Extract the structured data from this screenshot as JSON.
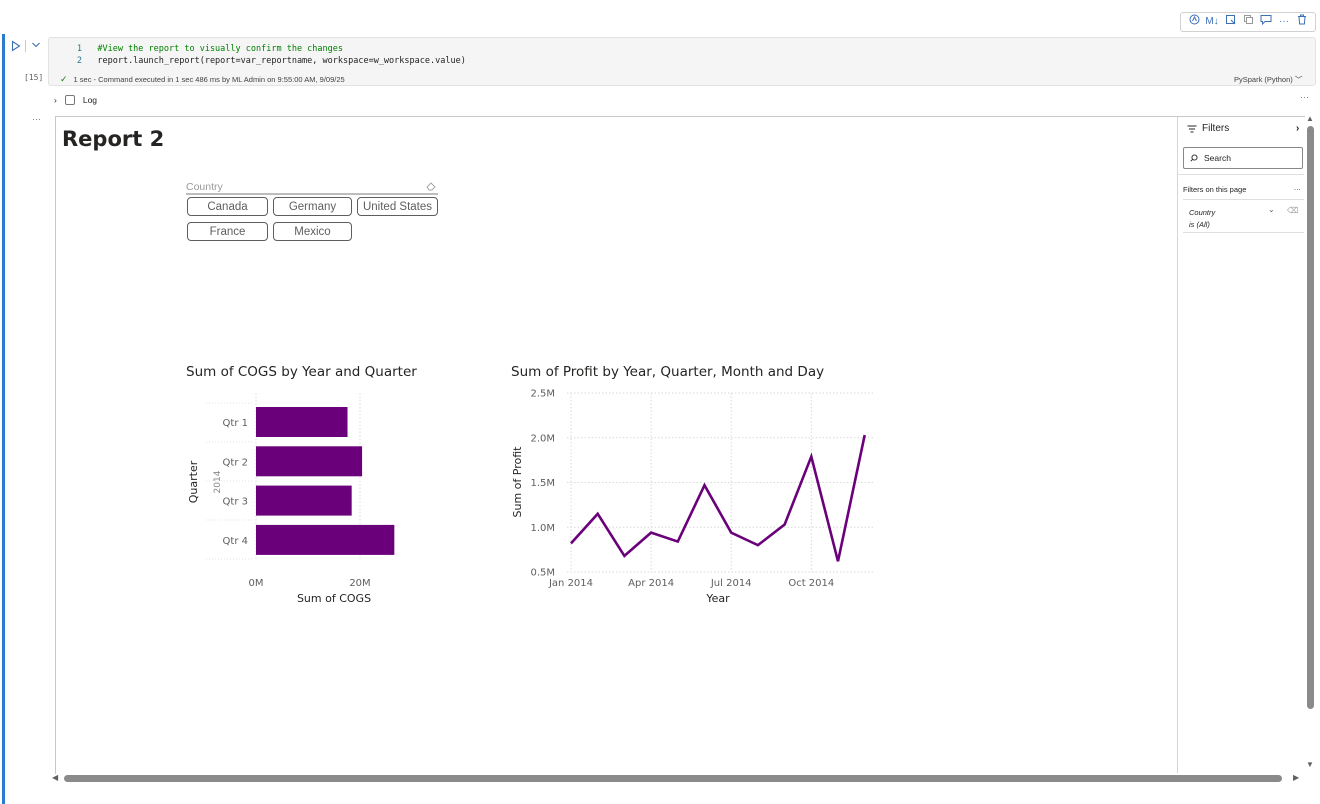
{
  "toolbar": {
    "icons": [
      "copilot-icon",
      "markdown-icon",
      "freeze-icon",
      "copy-icon",
      "comment-icon",
      "more-icon",
      "delete-icon"
    ],
    "markdown_label": "M↓"
  },
  "cell": {
    "execution_count": "[15]",
    "code_lines": [
      {
        "num": "1",
        "text": "#View the report to visually confirm the changes"
      },
      {
        "num": "2",
        "text": "report.launch_report(report=var_reportname, workspace=w_workspace.value)"
      }
    ],
    "status": "1 sec - Command executed in 1 sec 486 ms by ML Admin on 9:55:00 AM, 9/09/25",
    "kernel": "PySpark (Python)",
    "kernel_chevron": "﹀"
  },
  "log": {
    "label": "Log"
  },
  "more_dots": "···",
  "report": {
    "title": "Report 2",
    "slicer": {
      "title": "Country",
      "options": [
        "Canada",
        "Germany",
        "United States",
        "France",
        "Mexico"
      ]
    }
  },
  "filters": {
    "title": "Filters",
    "search_placeholder": "Search",
    "section": "Filters on this page",
    "section_more": "...",
    "card_field": "Country",
    "card_condition": "is (All)"
  },
  "colors": {
    "bar": "#6b007b",
    "line": "#6b007b",
    "accent": "#2b7bd0"
  },
  "chart_data": [
    {
      "type": "bar",
      "title": "Sum of COGS by Year and Quarter",
      "xlabel": "Sum of COGS",
      "ylabel": "Quarter",
      "group_label": "2014",
      "categories": [
        "Qtr 1",
        "Qtr 2",
        "Qtr 3",
        "Qtr 4"
      ],
      "values": [
        17.6,
        20.4,
        18.4,
        26.6
      ],
      "xlim": [
        0,
        30
      ],
      "xticks": [
        "0M",
        "20M"
      ],
      "xtick_values": [
        0,
        20
      ],
      "grid": true
    },
    {
      "type": "line",
      "title": "Sum of Profit by Year, Quarter, Month and Day",
      "xlabel": "Year",
      "ylabel": "Sum of Profit",
      "x": [
        "2014-01",
        "2014-02",
        "2014-03",
        "2014-04",
        "2014-05",
        "2014-06",
        "2014-07",
        "2014-08",
        "2014-09",
        "2014-10",
        "2014-11",
        "2014-12"
      ],
      "values": [
        0.82,
        1.15,
        0.68,
        0.94,
        0.84,
        1.47,
        0.94,
        0.8,
        1.03,
        1.79,
        0.62,
        2.03
      ],
      "ylim": [
        0.5,
        2.5
      ],
      "yticks": [
        "0.5M",
        "1.0M",
        "1.5M",
        "2.0M",
        "2.5M"
      ],
      "ytick_values": [
        0.5,
        1.0,
        1.5,
        2.0,
        2.5
      ],
      "xticks": [
        "Jan 2014",
        "Apr 2014",
        "Jul 2014",
        "Oct 2014"
      ],
      "xtick_index": [
        0,
        3,
        6,
        9
      ],
      "grid": true
    }
  ]
}
